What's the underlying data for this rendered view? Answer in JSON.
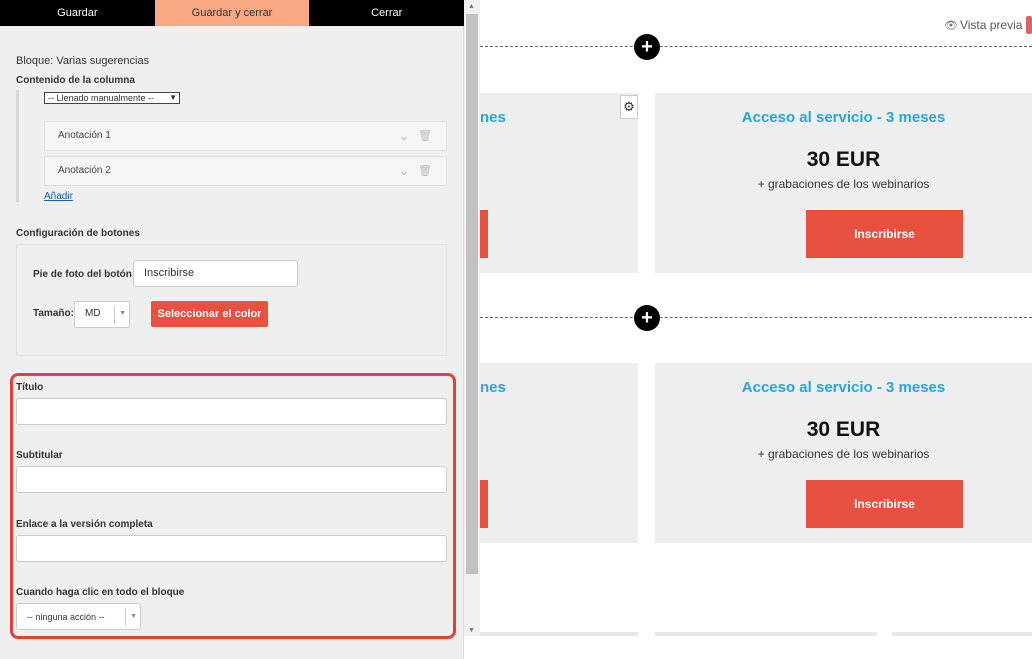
{
  "toolbar": {
    "save": "Guardar",
    "save_close": "Guardar y cerrar",
    "close": "Cerrar"
  },
  "panel": {
    "block_title": "Bloque: Varias sugerencias",
    "column_content_label": "Contenido de la columna",
    "fill_mode": "-- Llenado manualmente --",
    "annotations": [
      "Anotación 1",
      "Anotación 2"
    ],
    "add_link": "Añadir",
    "buttons_config_label": "Configuración de botones",
    "caption_label": "Pie de foto del botón:",
    "caption_value": "Inscribirse",
    "size_label": "Tamaño:",
    "size_value": "MD",
    "select_color": "Seleccionar el color",
    "title_label": "Título",
    "subtitle_label": "Subtitular",
    "full_version_label": "Enlace a la versión completa",
    "click_label": "Cuando haga clic en todo el bloque",
    "click_value": "-- ninguna acción --"
  },
  "canvas": {
    "preview_label": "Vista previa",
    "partial_title": "nes",
    "cards": [
      {
        "title": "Acceso al servicio - 3 meses",
        "price": "30 EUR",
        "subtitle": "+ grabaciones de los webinarios",
        "button": "Inscribirse"
      },
      {
        "title": "Acceso al servicio - 3 meses",
        "price": "30 EUR",
        "subtitle": "+ grabaciones de los webinarios",
        "button": "Inscribirse"
      }
    ]
  },
  "colors": {
    "accent_red": "#e8513f",
    "title_blue": "#27a6de",
    "active_tab": "#f9a885",
    "highlight": "#e0413a"
  },
  "icons": [
    "chevron-down-icon",
    "trash-icon",
    "plus-icon",
    "gear-icon",
    "eye-icon"
  ]
}
